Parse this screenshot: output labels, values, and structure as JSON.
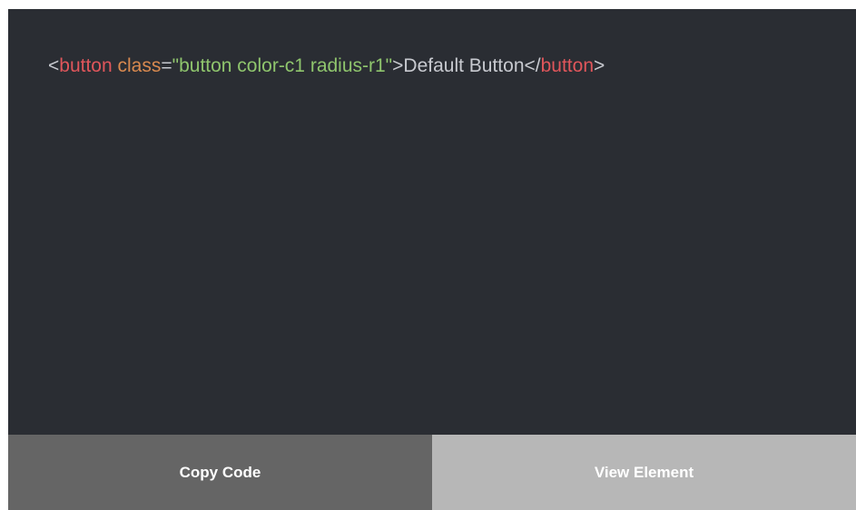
{
  "code_snippet": {
    "tokens": [
      {
        "kind": "punct",
        "text": "<"
      },
      {
        "kind": "tag",
        "text": "button"
      },
      {
        "kind": "text",
        "text": " "
      },
      {
        "kind": "attr",
        "text": "class"
      },
      {
        "kind": "punct",
        "text": "="
      },
      {
        "kind": "str",
        "text": "\"button color-c1 radius-r1\""
      },
      {
        "kind": "punct",
        "text": ">"
      },
      {
        "kind": "text",
        "text": "Default Button"
      },
      {
        "kind": "punct",
        "text": "</"
      },
      {
        "kind": "tag",
        "text": "button"
      },
      {
        "kind": "punct",
        "text": ">"
      }
    ]
  },
  "actions": {
    "copy_label": "Copy Code",
    "view_label": "View Element"
  },
  "colors": {
    "background": "#2a2d33",
    "tag": "#e0565b",
    "attribute": "#d8894f",
    "string": "#8fc56d",
    "text": "#c8cad0",
    "copy_button_bg": "#656565",
    "view_button_bg": "#b7b7b7"
  }
}
